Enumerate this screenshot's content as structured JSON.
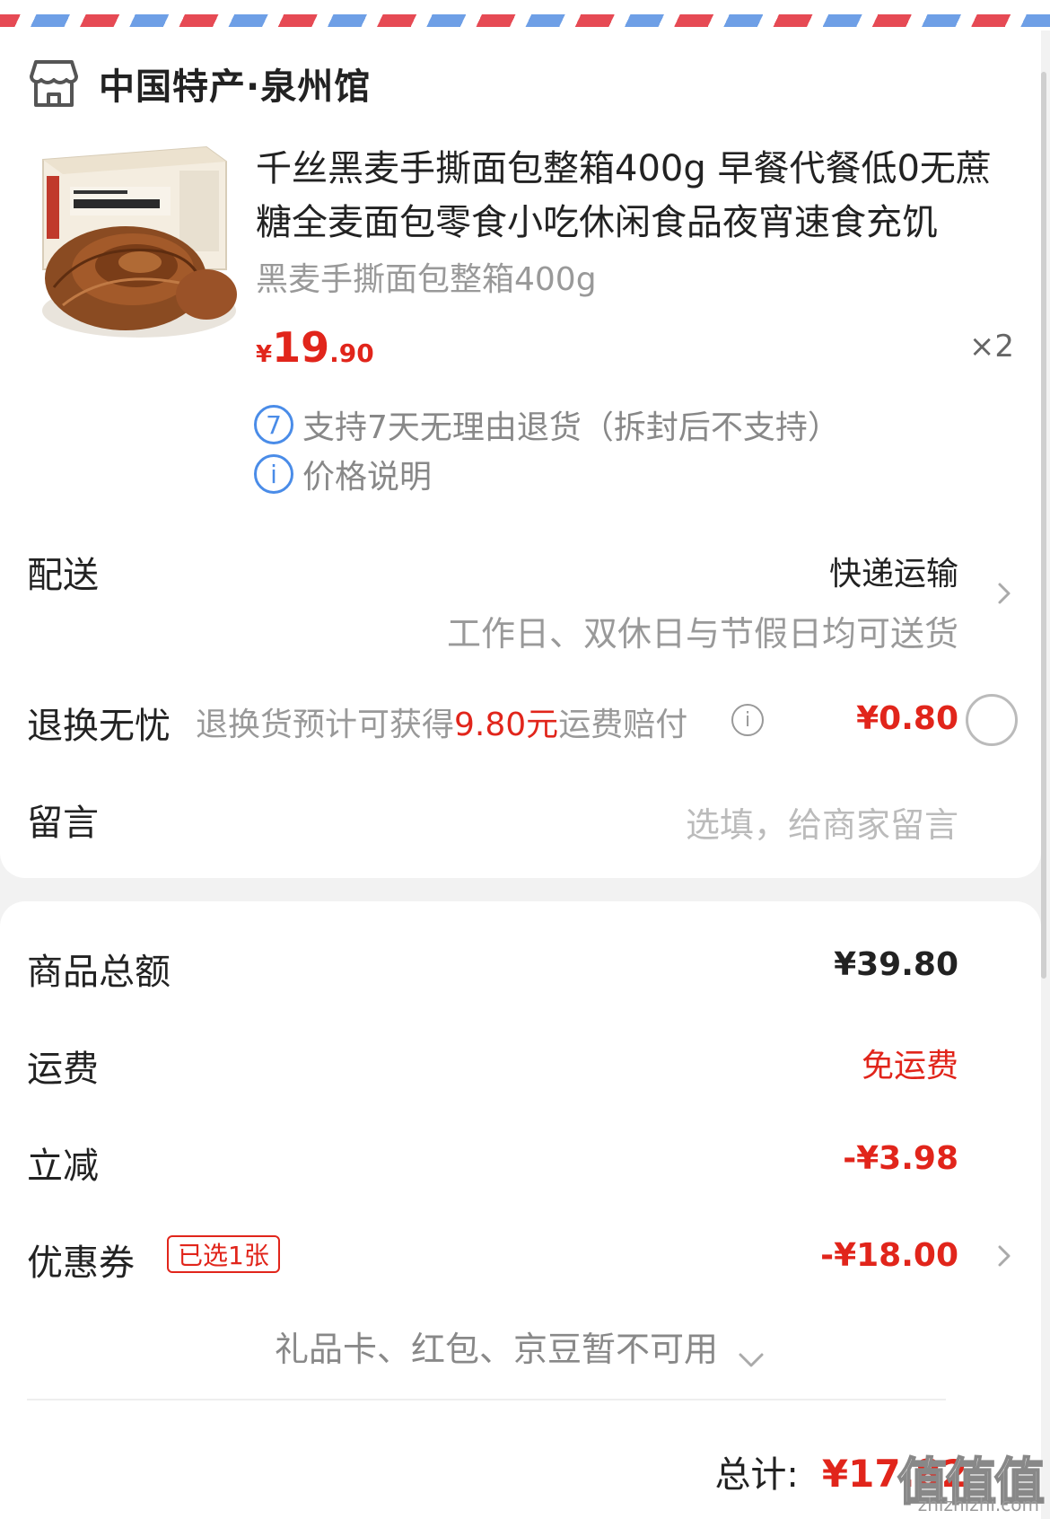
{
  "store": {
    "icon": "store-icon",
    "name": "中国特产·泉州馆"
  },
  "product": {
    "image": "bread-box-image",
    "title": "千丝黑麦手撕面包整箱400g 早餐代餐低0无蔗糖全麦面包零食小吃休闲食品夜宵速食充饥",
    "spec": "黑麦手撕面包整箱400g",
    "price_symbol": "¥",
    "price_int": "19",
    "price_dec": ".90",
    "quantity": "×2",
    "services": [
      {
        "badge": "7",
        "text": "支持7天无理由退货（拆封后不支持）",
        "icon": "seven-day-return-icon"
      },
      {
        "badge": "i",
        "text": "价格说明",
        "icon": "info-icon"
      }
    ]
  },
  "delivery": {
    "label": "配送",
    "method": "快递运输",
    "note": "工作日、双休日与节假日均可送货"
  },
  "return_worry": {
    "label": "退换无忧",
    "desc_prefix": "退换货预计可获得",
    "desc_highlight": "9.80元",
    "desc_suffix": "运费赔付",
    "price": "¥0.80",
    "selected": false
  },
  "message": {
    "label": "留言",
    "placeholder": "选填，给商家留言"
  },
  "summary": {
    "goods_total_label": "商品总额",
    "goods_total": "¥39.80",
    "shipping_label": "运费",
    "shipping": "免运费",
    "discount_label": "立减",
    "discount": "-¥3.98",
    "coupon_label": "优惠券",
    "coupon_tag": "已选1张",
    "coupon_amount": "-¥18.00",
    "unavailable": "礼品卡、红包、京豆暂不可用",
    "total_label": "总计:",
    "total": "¥17.82"
  },
  "watermark": {
    "logo": "值值值",
    "site": "zhizhizhi.com"
  },
  "colors": {
    "accent_red": "#e1251b",
    "link_blue": "#4a8ce8",
    "stripe_red": "#e64a54",
    "stripe_blue": "#6e9fe6"
  }
}
